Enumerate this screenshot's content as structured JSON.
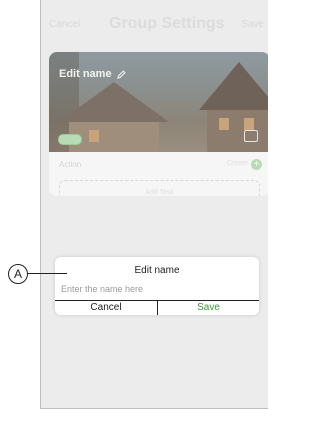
{
  "header": {
    "cancel": "Cancel",
    "title": "Group Settings",
    "save": "Save"
  },
  "card": {
    "edit_name": "Edit name",
    "action_label": "Action",
    "create_label": "Create",
    "add_task": "Add Task"
  },
  "dialog": {
    "title": "Edit name",
    "input_placeholder": "Enter the name here",
    "input_value": "",
    "cancel": "Cancel",
    "save": "Save"
  },
  "callout": {
    "label": "A"
  },
  "colors": {
    "save_accent": "#3a9a35"
  }
}
